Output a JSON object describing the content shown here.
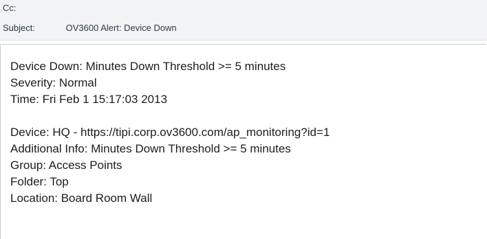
{
  "header": {
    "cc_label": "Cc:",
    "cc_value": "",
    "subject_label": "Subject:",
    "subject_value": "OV3600 Alert: Device Down"
  },
  "message": {
    "block1": [
      "Device Down: Minutes Down Threshold >= 5 minutes",
      "Severity: Normal",
      "Time: Fri Feb  1 15:17:03 2013"
    ],
    "block2": [
      "Device: HQ - https://tipi.corp.ov3600.com/ap_monitoring?id=1",
      "Additional Info: Minutes Down Threshold >= 5 minutes",
      "Group: Access Points",
      "Folder: Top",
      "Location:  Board Room Wall"
    ]
  }
}
